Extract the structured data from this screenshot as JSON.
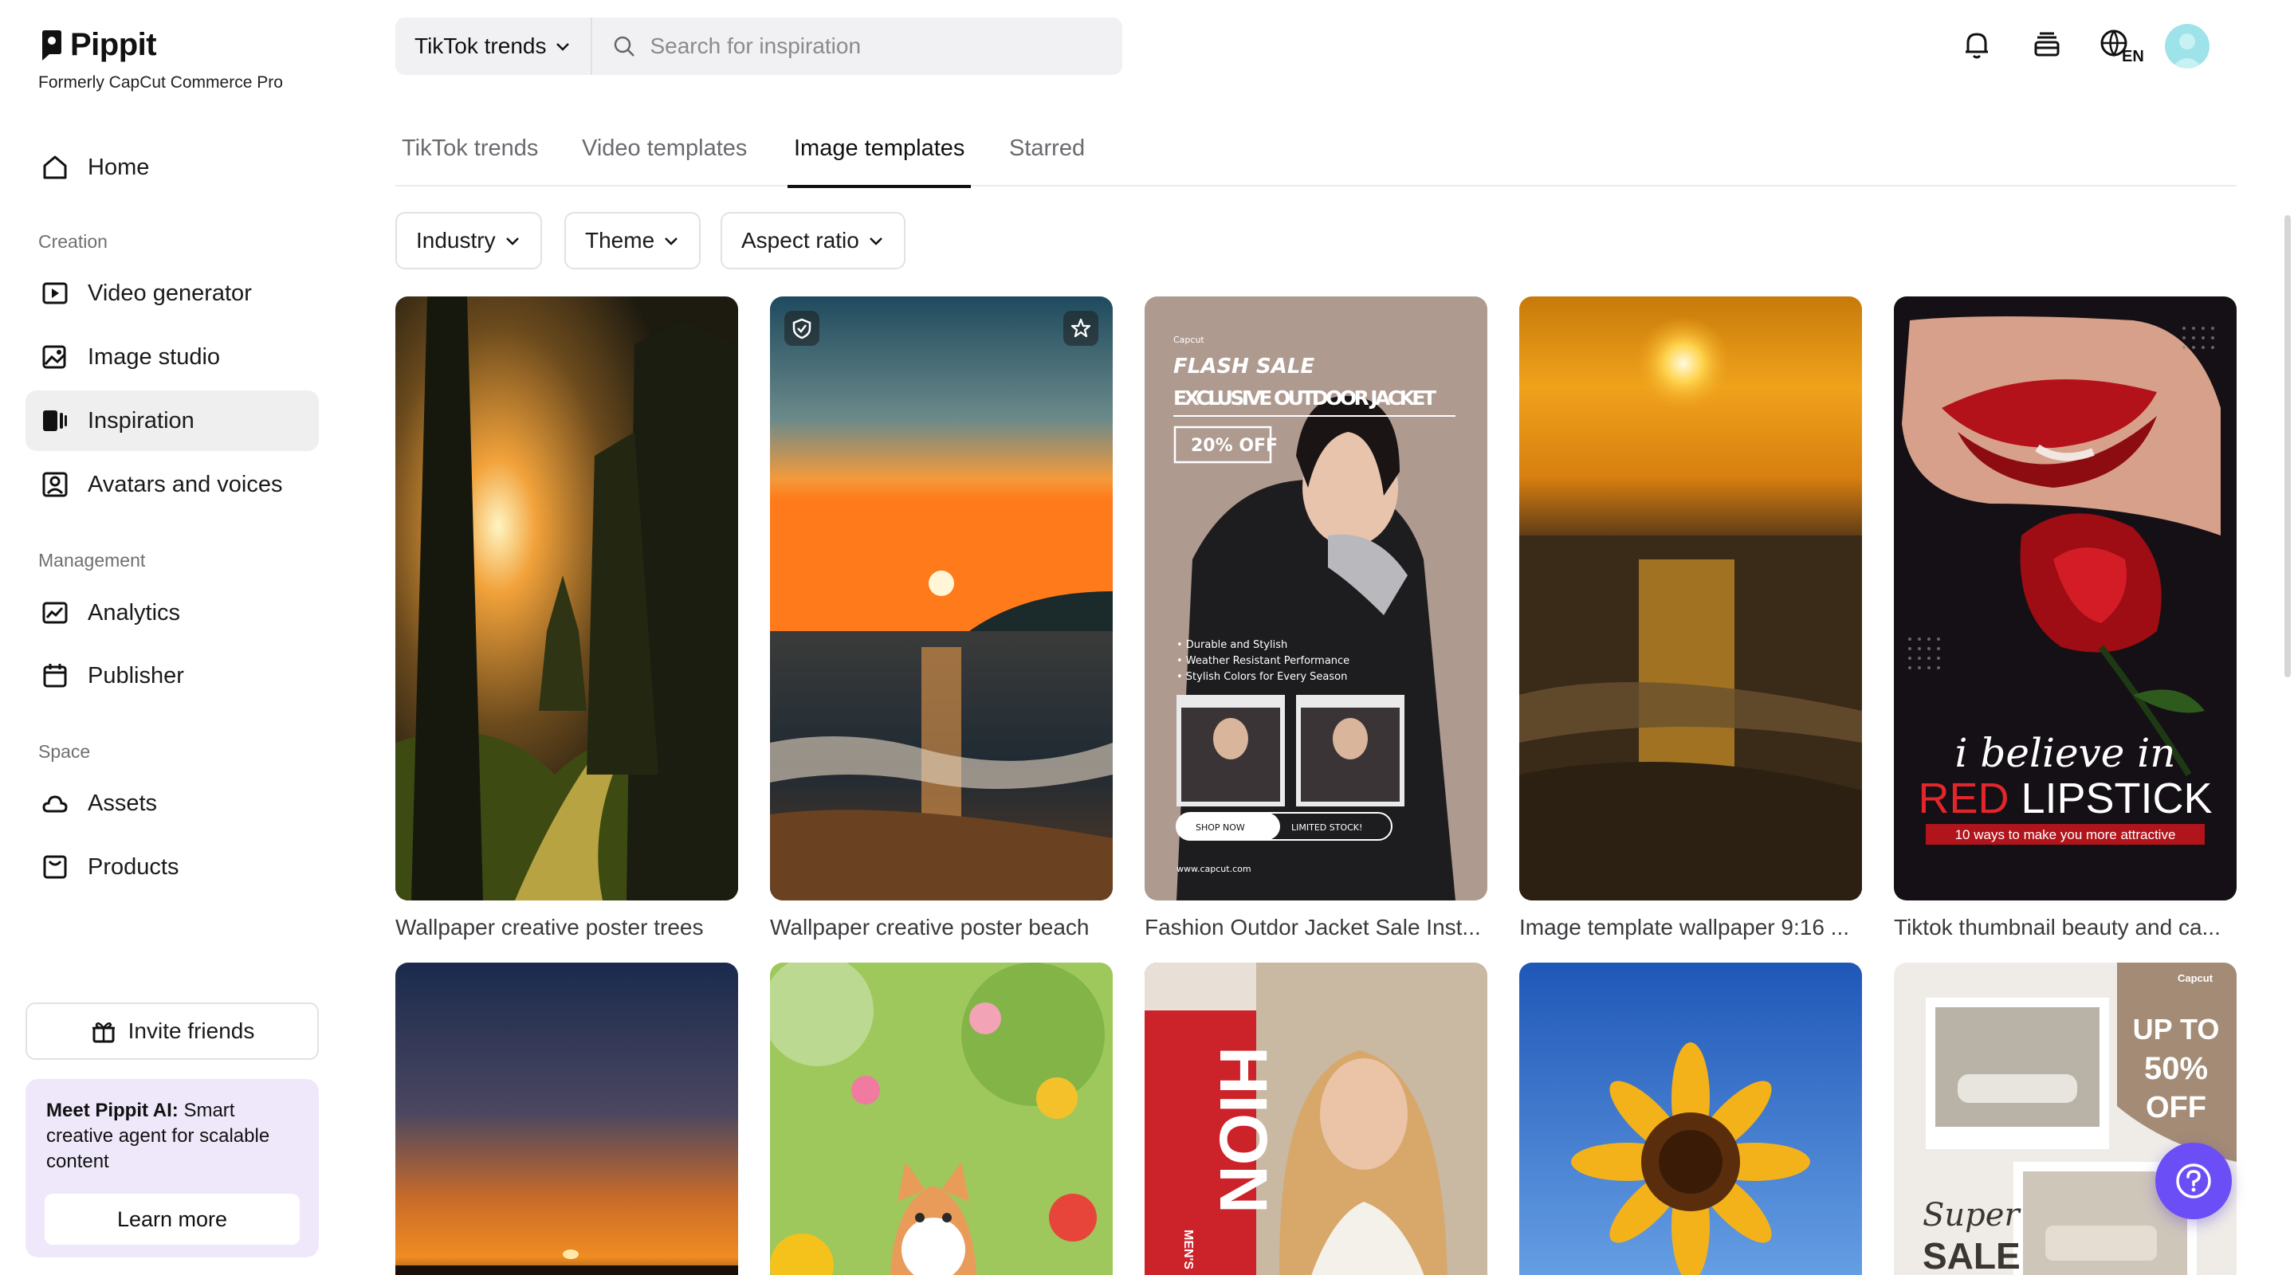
{
  "app": {
    "name": "Pippit",
    "subtitle": "Formerly CapCut Commerce Pro"
  },
  "sidebar": {
    "home": "Home",
    "sections": {
      "creation": "Creation",
      "management": "Management",
      "space": "Space"
    },
    "creation_items": [
      "Video generator",
      "Image studio",
      "Inspiration",
      "Avatars and voices"
    ],
    "management_items": [
      "Analytics",
      "Publisher"
    ],
    "space_items": [
      "Assets",
      "Products"
    ],
    "active_item": "Inspiration",
    "invite_label": "Invite friends",
    "promo": {
      "bold": "Meet Pippit AI:",
      "text": " Smart creative agent for scalable content",
      "button": "Learn more"
    }
  },
  "topbar": {
    "category_select": "TikTok trends",
    "search_placeholder": "Search for inspiration",
    "language": "EN"
  },
  "tabs": [
    "TikTok trends",
    "Video templates",
    "Image templates",
    "Starred"
  ],
  "active_tab": "Image templates",
  "filters": [
    "Industry",
    "Theme",
    "Aspect ratio"
  ],
  "templates": [
    {
      "title": "Wallpaper creative poster trees"
    },
    {
      "title": "Wallpaper creative poster beach"
    },
    {
      "title": "Fashion Outdor Jacket Sale Inst..."
    },
    {
      "title": "Image template wallpaper 9:16 ..."
    },
    {
      "title": "Tiktok thumbnail beauty and ca..."
    }
  ],
  "template_overlays": {
    "jacket": {
      "brand": "Capcut",
      "headline1": "FLASH SALE",
      "headline2": "EXCLUSIVE OUTDOOR JACKET",
      "discount": "20% OFF",
      "bullets": [
        "• Durable and Stylish",
        "• Weather Resistant Performance",
        "• Stylish Colors for Every Season"
      ],
      "shop_now": "SHOP NOW",
      "limited": "LIMITED STOCK!",
      "url": "www.capcut.com"
    },
    "lipstick": {
      "line1": "i believe in",
      "line2_red": "RED",
      "line2_white": " LIPSTICK",
      "line3": "10 ways to make you more attractive"
    },
    "fashion": {
      "vertical": "HION",
      "small": "MEN'S"
    },
    "furniture": {
      "brand": "Capcut",
      "up_to": "UP TO",
      "percent": "50%",
      "off": "OFF",
      "super": "Super",
      "sale": "SALE"
    }
  },
  "colors": {
    "accent_purple": "#6b4ef5",
    "promo_bg": "#efe8fb",
    "active_nav_bg": "#efeff0",
    "lipstick_red": "#e3262b"
  }
}
